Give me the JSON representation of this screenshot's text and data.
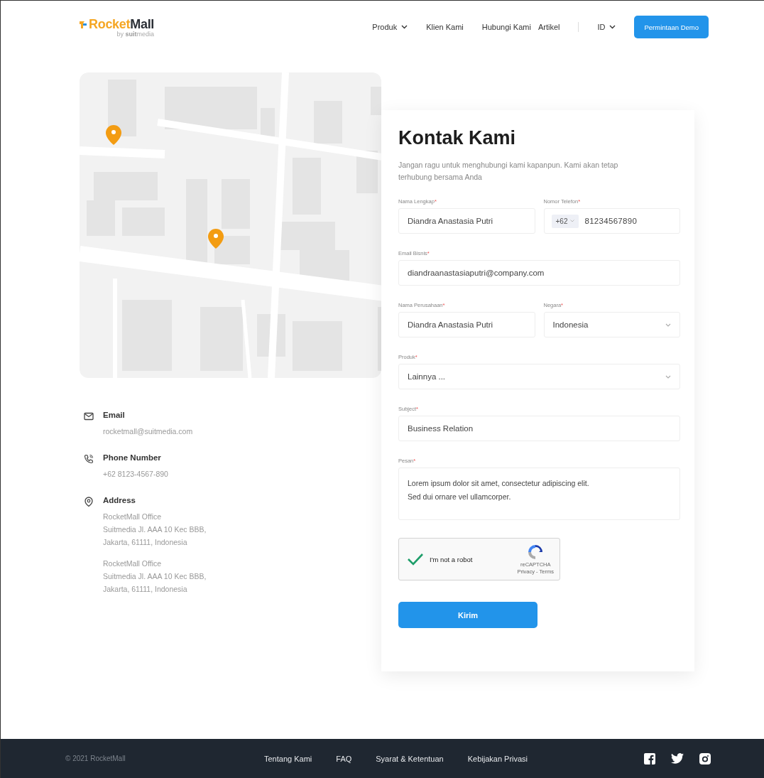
{
  "header": {
    "logo": {
      "name_part_1": "Rocket",
      "name_part_2": "Mall",
      "tagline_part_1": "by ",
      "tagline_part_2": "suit",
      "tagline_part_3": "media"
    },
    "nav": [
      {
        "label": "Produk",
        "kind": "dropdown"
      },
      {
        "label": "Klien Kami",
        "kind": "link"
      },
      {
        "label": "Hubungi Kami",
        "kind": "link"
      },
      {
        "label": "Artikel",
        "kind": "link"
      }
    ],
    "language": "ID",
    "cta": "Permintaan Demo"
  },
  "contact_info": [
    {
      "kind": "email",
      "title": "Email",
      "paragraphs": [
        [
          "rocketmall@suitmedia.com"
        ]
      ]
    },
    {
      "kind": "phone",
      "title": "Phone Number",
      "paragraphs": [
        [
          "+62 8123-4567-890"
        ]
      ]
    },
    {
      "kind": "address",
      "title": "Address",
      "paragraphs": [
        [
          "RocketMall Office",
          "Suitmedia Jl. AAA 10 Kec BBB,",
          "Jakarta, 61111, Indonesia"
        ],
        [
          "RocketMall Office",
          "Suitmedia Jl. AAA 10 Kec BBB,",
          "Jakarta, 61111, Indonesia"
        ]
      ]
    }
  ],
  "form": {
    "title": "Kontak Kami",
    "intro": "Jangan ragu untuk menghubungi kami kapanpun. Kami akan tetap terhubung bersama Anda",
    "rows": [
      [
        {
          "kind": "input",
          "label": "Nama Lengkap",
          "required_mark": "*",
          "value": "Diandra Anastasia Putri"
        },
        {
          "kind": "phone",
          "label": "Nomor Telefon",
          "required_mark": "*",
          "prefix": "+62",
          "value": "81234567890"
        }
      ],
      [
        {
          "kind": "input",
          "label": "Email Bisnis",
          "required_mark": "*",
          "value": "diandraanastasiaputri@company.com"
        }
      ],
      [
        {
          "kind": "input",
          "label": "Nama Perusahaan",
          "required_mark": "*",
          "value": "Diandra Anastasia Putri"
        },
        {
          "kind": "select",
          "label": "Negara",
          "required_mark": "*",
          "value": "Indonesia"
        }
      ],
      [
        {
          "kind": "select",
          "label": "Produk",
          "required_mark": "*",
          "value": "Lainnya ..."
        }
      ],
      [
        {
          "kind": "input",
          "label": "Subject",
          "required_mark": "*",
          "value": "Business Relation"
        }
      ],
      [
        {
          "kind": "textarea",
          "label": "Pesan",
          "required_mark": "*",
          "value": "Lorem ipsum dolor sit amet, consectetur adipiscing elit.\nSed dui ornare vel ullamcorper."
        }
      ]
    ],
    "captcha": {
      "checked": true,
      "label": "I'm not a robot",
      "brand": "reCAPTCHA",
      "links": "Privacy - Terms"
    },
    "submit": "Kirim"
  },
  "footer": {
    "copyright": "© 2021 RocketMall",
    "links": [
      "Tentang Kami",
      "FAQ",
      "Syarat & Ketentuan",
      "Kebijakan Privasi"
    ]
  }
}
